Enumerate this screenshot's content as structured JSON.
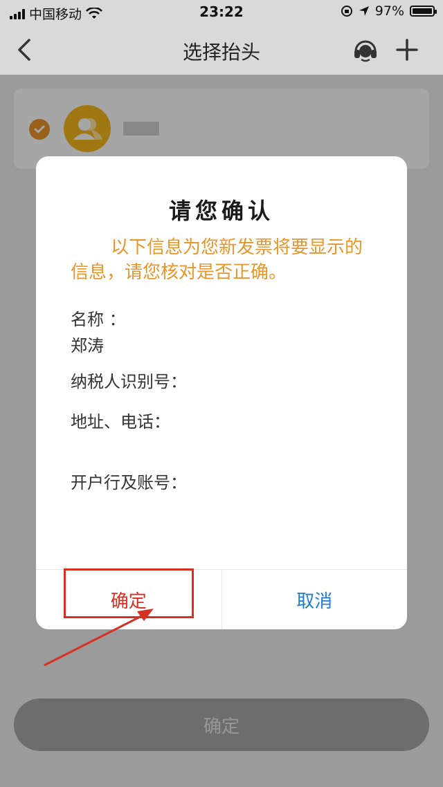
{
  "status_bar": {
    "carrier": "中国移动",
    "time": "23:22",
    "battery": "97%"
  },
  "nav": {
    "title": "选择抬头"
  },
  "dialog": {
    "title": "请您确认",
    "notice": "以下信息为您新发票将要显示的信息，请您核对是否正确。",
    "fields": {
      "name_label": "名称  ：",
      "name_value": "郑涛",
      "tax_label": "纳税人识别号：",
      "addr_label": "地址、电话：",
      "bank_label": "开户行及账号："
    },
    "confirm_label": "确定",
    "cancel_label": "取消"
  },
  "bottom_button": {
    "label": "确定"
  },
  "colors": {
    "accent": "#e8962a",
    "danger": "#d72f22",
    "link": "#1f7ad4",
    "avatar": "#f5b81f"
  },
  "icons": [
    "back-icon",
    "headset-icon",
    "plus-icon",
    "wifi-icon",
    "check-icon",
    "user-icon"
  ]
}
